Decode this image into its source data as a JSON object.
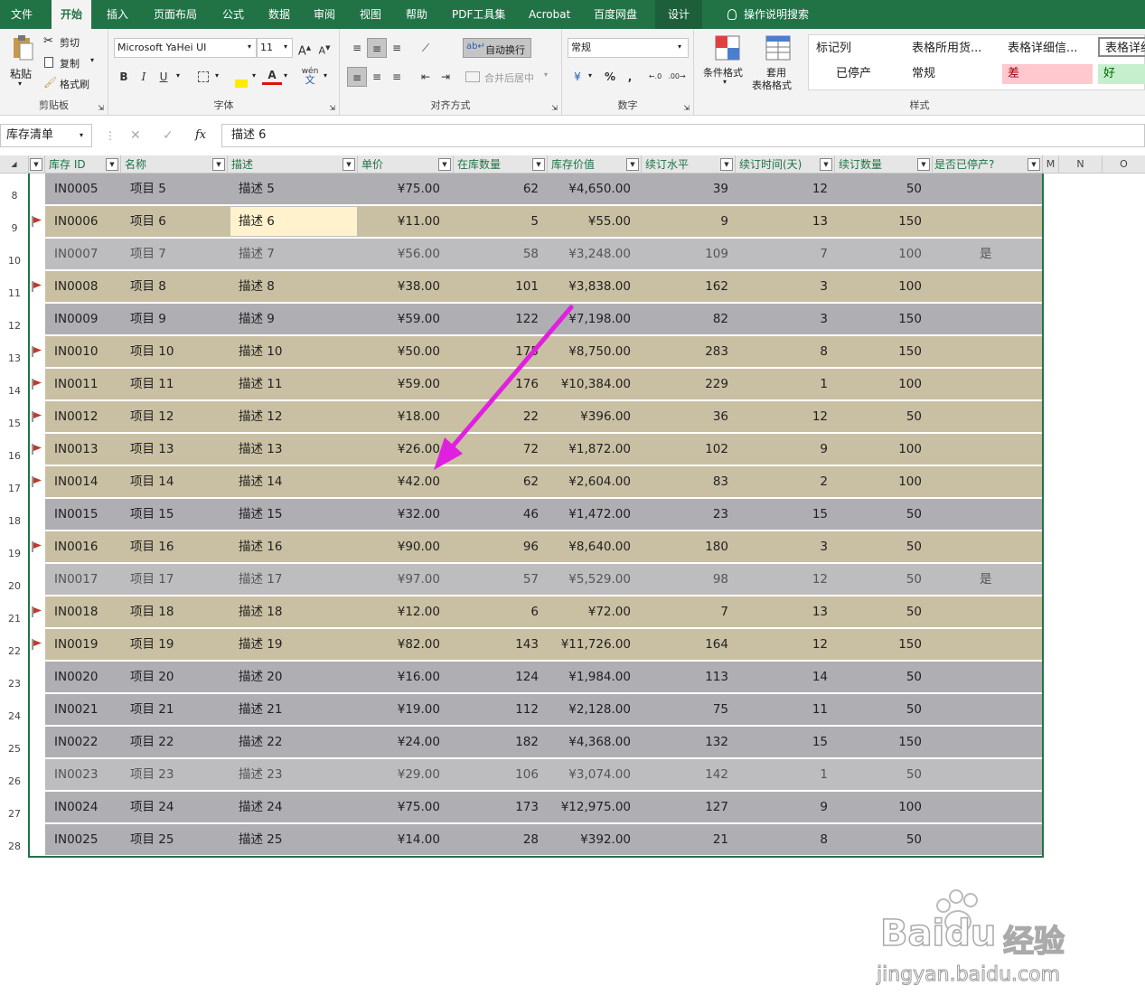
{
  "tabs": [
    "文件",
    "开始",
    "插入",
    "页面布局",
    "公式",
    "数据",
    "审阅",
    "视图",
    "帮助",
    "PDF工具集",
    "Acrobat",
    "百度网盘",
    "设计"
  ],
  "tell_me": "操作说明搜索",
  "clipboard": {
    "paste": "粘贴",
    "cut": "剪切",
    "copy": "复制",
    "format_painter": "格式刷",
    "label": "剪贴板"
  },
  "font": {
    "name": "Microsoft YaHei UI",
    "size": "11",
    "bold": "B",
    "italic": "I",
    "underline": "U",
    "label": "字体",
    "grow": "A",
    "shrink": "A",
    "wen": "wén",
    "wen_char": "文"
  },
  "alignment": {
    "wrap": "自动换行",
    "merge": "合并后居中",
    "label": "对齐方式"
  },
  "number": {
    "format": "常规",
    "label": "数字",
    "currency": "¥",
    "percent": "%",
    "comma": ","
  },
  "styles_group": {
    "cond_format": "条件格式",
    "table_format_1": "套用",
    "table_format_2": "表格格式",
    "label": "样式"
  },
  "cell_styles": [
    "标记列",
    "表格所用货...",
    "表格详细信...",
    "表格详细",
    "已停产",
    "常规",
    "差",
    "好"
  ],
  "formula_bar": {
    "name_box": "库存清单",
    "content": "描述 6",
    "fx": "fx"
  },
  "columns": [
    "库存 ID",
    "名称",
    "描述",
    "单价",
    "在库数量",
    "库存价值",
    "续订水平",
    "续订时间(天)",
    "续订数量",
    "是否已停产?"
  ],
  "extra_cols": [
    "M",
    "N",
    "O"
  ],
  "rows": [
    {
      "n": "8",
      "id": "IN0005",
      "name": "项目 5",
      "desc": "描述 5",
      "price": "¥75.00",
      "qty": "62",
      "value": "¥4,650.00",
      "level": "39",
      "days": "12",
      "reorder": "50",
      "disc": "",
      "style": "gray",
      "flag": false
    },
    {
      "n": "9",
      "id": "IN0006",
      "name": "项目 6",
      "desc": "描述 6",
      "price": "¥11.00",
      "qty": "5",
      "value": "¥55.00",
      "level": "9",
      "days": "13",
      "reorder": "150",
      "disc": "",
      "style": "tan",
      "flag": true
    },
    {
      "n": "10",
      "id": "IN0007",
      "name": "项目 7",
      "desc": "描述 7",
      "price": "¥56.00",
      "qty": "58",
      "value": "¥3,248.00",
      "level": "109",
      "days": "7",
      "reorder": "100",
      "disc": "是",
      "style": "disc",
      "flag": false
    },
    {
      "n": "11",
      "id": "IN0008",
      "name": "项目 8",
      "desc": "描述 8",
      "price": "¥38.00",
      "qty": "101",
      "value": "¥3,838.00",
      "level": "162",
      "days": "3",
      "reorder": "100",
      "disc": "",
      "style": "tan",
      "flag": true
    },
    {
      "n": "12",
      "id": "IN0009",
      "name": "项目 9",
      "desc": "描述 9",
      "price": "¥59.00",
      "qty": "122",
      "value": "¥7,198.00",
      "level": "82",
      "days": "3",
      "reorder": "150",
      "disc": "",
      "style": "gray",
      "flag": false
    },
    {
      "n": "13",
      "id": "IN0010",
      "name": "项目 10",
      "desc": "描述 10",
      "price": "¥50.00",
      "qty": "175",
      "value": "¥8,750.00",
      "level": "283",
      "days": "8",
      "reorder": "150",
      "disc": "",
      "style": "tan",
      "flag": true
    },
    {
      "n": "14",
      "id": "IN0011",
      "name": "项目 11",
      "desc": "描述 11",
      "price": "¥59.00",
      "qty": "176",
      "value": "¥10,384.00",
      "level": "229",
      "days": "1",
      "reorder": "100",
      "disc": "",
      "style": "tan",
      "flag": true
    },
    {
      "n": "15",
      "id": "IN0012",
      "name": "项目 12",
      "desc": "描述 12",
      "price": "¥18.00",
      "qty": "22",
      "value": "¥396.00",
      "level": "36",
      "days": "12",
      "reorder": "50",
      "disc": "",
      "style": "tan",
      "flag": true
    },
    {
      "n": "16",
      "id": "IN0013",
      "name": "项目 13",
      "desc": "描述 13",
      "price": "¥26.00",
      "qty": "72",
      "value": "¥1,872.00",
      "level": "102",
      "days": "9",
      "reorder": "100",
      "disc": "",
      "style": "tan",
      "flag": true
    },
    {
      "n": "17",
      "id": "IN0014",
      "name": "项目 14",
      "desc": "描述 14",
      "price": "¥42.00",
      "qty": "62",
      "value": "¥2,604.00",
      "level": "83",
      "days": "2",
      "reorder": "100",
      "disc": "",
      "style": "tan",
      "flag": true
    },
    {
      "n": "18",
      "id": "IN0015",
      "name": "项目 15",
      "desc": "描述 15",
      "price": "¥32.00",
      "qty": "46",
      "value": "¥1,472.00",
      "level": "23",
      "days": "15",
      "reorder": "50",
      "disc": "",
      "style": "gray",
      "flag": false
    },
    {
      "n": "19",
      "id": "IN0016",
      "name": "项目 16",
      "desc": "描述 16",
      "price": "¥90.00",
      "qty": "96",
      "value": "¥8,640.00",
      "level": "180",
      "days": "3",
      "reorder": "50",
      "disc": "",
      "style": "tan",
      "flag": true
    },
    {
      "n": "20",
      "id": "IN0017",
      "name": "项目 17",
      "desc": "描述 17",
      "price": "¥97.00",
      "qty": "57",
      "value": "¥5,529.00",
      "level": "98",
      "days": "12",
      "reorder": "50",
      "disc": "是",
      "style": "disc",
      "flag": false
    },
    {
      "n": "21",
      "id": "IN0018",
      "name": "项目 18",
      "desc": "描述 18",
      "price": "¥12.00",
      "qty": "6",
      "value": "¥72.00",
      "level": "7",
      "days": "13",
      "reorder": "50",
      "disc": "",
      "style": "tan",
      "flag": true
    },
    {
      "n": "22",
      "id": "IN0019",
      "name": "项目 19",
      "desc": "描述 19",
      "price": "¥82.00",
      "qty": "143",
      "value": "¥11,726.00",
      "level": "164",
      "days": "12",
      "reorder": "150",
      "disc": "",
      "style": "tan",
      "flag": true
    },
    {
      "n": "23",
      "id": "IN0020",
      "name": "项目 20",
      "desc": "描述 20",
      "price": "¥16.00",
      "qty": "124",
      "value": "¥1,984.00",
      "level": "113",
      "days": "14",
      "reorder": "50",
      "disc": "",
      "style": "gray",
      "flag": false
    },
    {
      "n": "24",
      "id": "IN0021",
      "name": "项目 21",
      "desc": "描述 21",
      "price": "¥19.00",
      "qty": "112",
      "value": "¥2,128.00",
      "level": "75",
      "days": "11",
      "reorder": "50",
      "disc": "",
      "style": "gray",
      "flag": false
    },
    {
      "n": "25",
      "id": "IN0022",
      "name": "项目 22",
      "desc": "描述 22",
      "price": "¥24.00",
      "qty": "182",
      "value": "¥4,368.00",
      "level": "132",
      "days": "15",
      "reorder": "150",
      "disc": "",
      "style": "gray",
      "flag": false
    },
    {
      "n": "26",
      "id": "IN0023",
      "name": "项目 23",
      "desc": "描述 23",
      "price": "¥29.00",
      "qty": "106",
      "value": "¥3,074.00",
      "level": "142",
      "days": "1",
      "reorder": "50",
      "disc": "",
      "style": "disc",
      "flag": false
    },
    {
      "n": "27",
      "id": "IN0024",
      "name": "项目 24",
      "desc": "描述 24",
      "price": "¥75.00",
      "qty": "173",
      "value": "¥12,975.00",
      "level": "127",
      "days": "9",
      "reorder": "100",
      "disc": "",
      "style": "gray",
      "flag": false
    },
    {
      "n": "28",
      "id": "IN0025",
      "name": "项目 25",
      "desc": "描述 25",
      "price": "¥14.00",
      "qty": "28",
      "value": "¥392.00",
      "level": "21",
      "days": "8",
      "reorder": "50",
      "disc": "",
      "style": "gray",
      "flag": false
    }
  ],
  "watermark": {
    "brand": "Bai",
    "brand2": "du",
    "cn": "经验",
    "url": "jingyan.baidu.com"
  },
  "colors": {
    "excel_green": "#217346",
    "row_gray": "#aeaeb3",
    "row_tan": "#c9bfa2",
    "flag_red": "#c0392b",
    "arrow": "#e020e0"
  }
}
